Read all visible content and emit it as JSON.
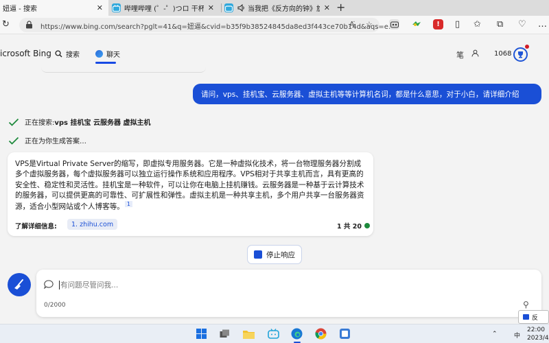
{
  "tabs": [
    {
      "label": "妞逼 - 搜索",
      "icon": "bing-icon",
      "active": true
    },
    {
      "label": "哔哩哔哩 (゜-゜)つロ 干杯~-bilibili",
      "icon": "bilibili-icon",
      "active": false
    },
    {
      "label": "当我把《反方向的钟》旋律...",
      "icon": "speaker-icon",
      "active": false
    }
  ],
  "address": {
    "url": "https://www.bing.com/search?pglt=41&q=妞逼&cvid=b35f9b38524845da8ed3f443ce70b14d&aqs=e..."
  },
  "bing": {
    "brand": "icrosoft Bing",
    "tab_search": "搜索",
    "tab_chat": "聊天",
    "notebook_label": "笔",
    "points": "1068"
  },
  "conversation": {
    "user_message": "请问，vps、挂机宝、云服务器、虚拟主机等等计算机名词，都是什么意思，对于小白，请详细介绍",
    "status_search_prefix": "正在搜索: ",
    "status_search_query": "vps 挂机宝 云服务器 虚拟主机",
    "status_generating": "正在为你生成答案…",
    "answer_text": "VPS是Virtual Private Server的缩写，即虚拟专用服务器。它是一种虚拟化技术，将一台物理服务器分割成多个虚拟服务器，每个虚拟服务器可以独立运行操作系统和应用程序。VPS相对于共享主机而言，具有更高的安全性、稳定性和灵活性。挂机宝是一种软件，可以让你在电脑上挂机赚钱。云服务器是一种基于云计算技术的服务器，可以提供更高的可靠性、可扩展性和弹性。虚拟主机是一种共享主机，多个用户共享一台服务器资源，适合小型网站或个人博客等。",
    "citation": "1",
    "learn_more_label": "了解详细信息:",
    "source_link": "1. zhihu.com",
    "turn_counter": "1 共 20"
  },
  "stop_button": {
    "label": "停止响应"
  },
  "input": {
    "placeholder": "有问题尽管问我...",
    "char_count": "0/2000"
  },
  "feedback": {
    "label": "反"
  },
  "taskbar": {
    "ime": "中",
    "time": "22:00",
    "date": "2023/4/"
  },
  "colors": {
    "accent": "#1a4fd6",
    "check": "#1e8a3c",
    "user_bubble": "#1a4fd6"
  }
}
